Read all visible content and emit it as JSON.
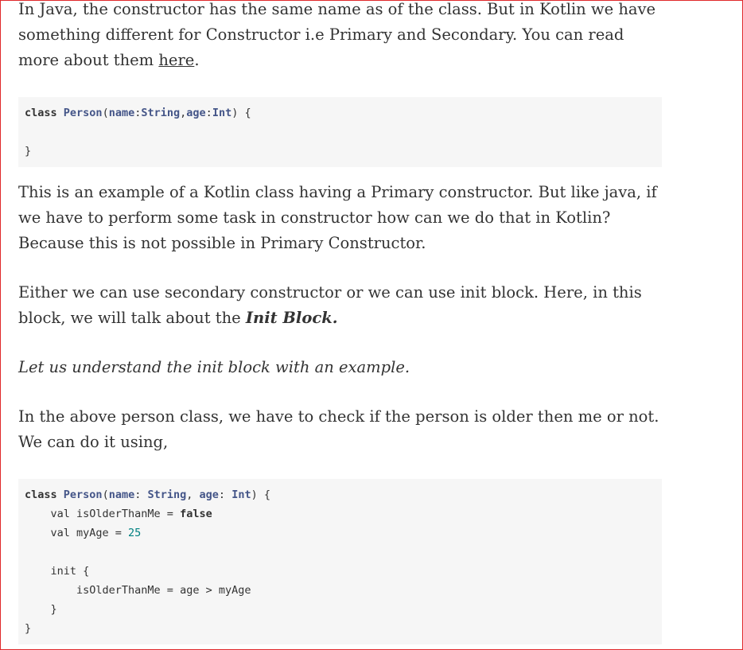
{
  "para1": {
    "before_link": "In Java, the constructor has the same name as of the class. But in Kotlin we have something different for Constructor i.e Primary and Secondary. You can read more about them ",
    "link_text": "here",
    "after_link": "."
  },
  "code1": {
    "lines": [
      {
        "kw": "class",
        "cls": "Person",
        "open": "(",
        "p1name": "name",
        "p1sep": ":",
        "p1type": "String",
        "comma": ",",
        "p2name": "age",
        "p2sep": ":",
        "p2type": "Int",
        "close": ") {"
      },
      {
        "text": ""
      },
      {
        "text": "}"
      }
    ]
  },
  "para2": "This is an example of a Kotlin class having a Primary constructor. But like java, if we have to perform some task in constructor how can we do that in Kotlin? Because this is not possible in Primary Constructor.",
  "para3": {
    "before": "Either we can use secondary constructor or we can use init block. Here, in this block, we will talk about the ",
    "strong": "Init Block."
  },
  "para4": "Let us understand the init block with an example.",
  "para5": "In the above person class, we have to check if the person is older then me or not. We can do it using,",
  "code2": {
    "line1": {
      "kw": "class",
      "cls": "Person",
      "open": "(",
      "p1name": "name",
      "p1sep": ": ",
      "p1type": "String",
      "comma": ", ",
      "p2name": "age",
      "p2sep": ": ",
      "p2type": "Int",
      "close": ") {"
    },
    "line2": {
      "prefix": "    val isOlderThanMe = ",
      "kw": "false"
    },
    "line3": {
      "prefix": "    val myAge = ",
      "num": "25"
    },
    "line4": "",
    "line5": "    init {",
    "line6": "        isOlderThanMe = age > myAge",
    "line7": "    }",
    "line8": "}"
  }
}
